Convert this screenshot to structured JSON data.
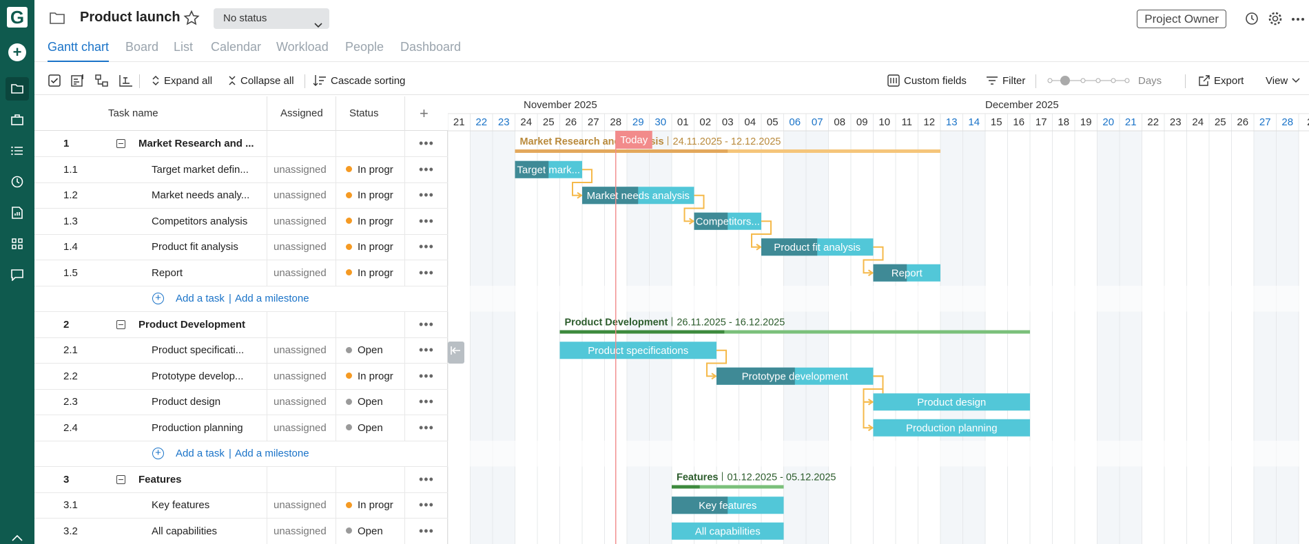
{
  "sidebar": {
    "logo": "G",
    "add_label": "+"
  },
  "header": {
    "title": "Product launch",
    "status_label": "No status",
    "owner_label": "Project Owner"
  },
  "tabs": [
    {
      "label": "Gantt chart",
      "active": true
    },
    {
      "label": "Board"
    },
    {
      "label": "List"
    },
    {
      "label": "Calendar"
    },
    {
      "label": "Workload"
    },
    {
      "label": "People"
    },
    {
      "label": "Dashboard"
    }
  ],
  "toolbar": {
    "expand_all": "Expand all",
    "collapse_all": "Collapse all",
    "cascade_sorting": "Cascade sorting",
    "custom_fields": "Custom fields",
    "filter": "Filter",
    "scale": "Days",
    "export": "Export",
    "view": "View"
  },
  "grid": {
    "headers": {
      "task_name": "Task name",
      "assigned": "Assigned",
      "status": "Status",
      "add": "+"
    },
    "add_task": "Add a task",
    "add_milestone": "Add a milestone",
    "rows": [
      {
        "type": "group",
        "num": "1",
        "name": "Market Research and ...",
        "assigned": "",
        "status": ""
      },
      {
        "type": "task",
        "num": "1.1",
        "name": "Target market defin...",
        "assigned": "unassigned",
        "status": "In progr",
        "status_color": "#f59a23"
      },
      {
        "type": "task",
        "num": "1.2",
        "name": "Market needs analy...",
        "assigned": "unassigned",
        "status": "In progr",
        "status_color": "#f59a23"
      },
      {
        "type": "task",
        "num": "1.3",
        "name": "Competitors analysis",
        "assigned": "unassigned",
        "status": "In progr",
        "status_color": "#f59a23"
      },
      {
        "type": "task",
        "num": "1.4",
        "name": "Product fit analysis",
        "assigned": "unassigned",
        "status": "In progr",
        "status_color": "#f59a23"
      },
      {
        "type": "task",
        "num": "1.5",
        "name": "Report",
        "assigned": "unassigned",
        "status": "In progr",
        "status_color": "#f59a23"
      },
      {
        "type": "add"
      },
      {
        "type": "group",
        "num": "2",
        "name": "Product Development",
        "assigned": "",
        "status": ""
      },
      {
        "type": "task",
        "num": "2.1",
        "name": "Product specificati...",
        "assigned": "unassigned",
        "status": "Open",
        "status_color": "#9a9a9a"
      },
      {
        "type": "task",
        "num": "2.2",
        "name": "Prototype develop...",
        "assigned": "unassigned",
        "status": "In progr",
        "status_color": "#f59a23"
      },
      {
        "type": "task",
        "num": "2.3",
        "name": "Product design",
        "assigned": "unassigned",
        "status": "Open",
        "status_color": "#9a9a9a"
      },
      {
        "type": "task",
        "num": "2.4",
        "name": "Production planning",
        "assigned": "unassigned",
        "status": "Open",
        "status_color": "#9a9a9a"
      },
      {
        "type": "add"
      },
      {
        "type": "group",
        "num": "3",
        "name": "Features",
        "assigned": "",
        "status": ""
      },
      {
        "type": "task",
        "num": "3.1",
        "name": "Key features",
        "assigned": "unassigned",
        "status": "In progr",
        "status_color": "#f59a23"
      },
      {
        "type": "task",
        "num": "3.2",
        "name": "All capabilities",
        "assigned": "unassigned",
        "status": "Open",
        "status_color": "#9a9a9a"
      }
    ]
  },
  "gantt": {
    "months": [
      {
        "label": "November 2025",
        "start_index": 0
      },
      {
        "label": "December 2025",
        "start_index": 10
      }
    ],
    "days": [
      {
        "d": "21",
        "we": false
      },
      {
        "d": "22",
        "we": true
      },
      {
        "d": "23",
        "we": true
      },
      {
        "d": "24",
        "we": false
      },
      {
        "d": "25",
        "we": false
      },
      {
        "d": "26",
        "we": false
      },
      {
        "d": "27",
        "we": false
      },
      {
        "d": "28",
        "we": false
      },
      {
        "d": "29",
        "we": true
      },
      {
        "d": "30",
        "we": true
      },
      {
        "d": "01",
        "we": false
      },
      {
        "d": "02",
        "we": false
      },
      {
        "d": "03",
        "we": false
      },
      {
        "d": "04",
        "we": false
      },
      {
        "d": "05",
        "we": false
      },
      {
        "d": "06",
        "we": true
      },
      {
        "d": "07",
        "we": true
      },
      {
        "d": "08",
        "we": false
      },
      {
        "d": "09",
        "we": false
      },
      {
        "d": "10",
        "we": false
      },
      {
        "d": "11",
        "we": false
      },
      {
        "d": "12",
        "we": false
      },
      {
        "d": "13",
        "we": true
      },
      {
        "d": "14",
        "we": true
      },
      {
        "d": "15",
        "we": false
      },
      {
        "d": "16",
        "we": false
      },
      {
        "d": "17",
        "we": false
      },
      {
        "d": "18",
        "we": false
      },
      {
        "d": "19",
        "we": false
      },
      {
        "d": "20",
        "we": true
      },
      {
        "d": "21",
        "we": true
      },
      {
        "d": "22",
        "we": false
      },
      {
        "d": "23",
        "we": false
      },
      {
        "d": "24",
        "we": false
      },
      {
        "d": "25",
        "we": false
      },
      {
        "d": "26",
        "we": false
      },
      {
        "d": "27",
        "we": true
      },
      {
        "d": "28",
        "we": true
      },
      {
        "d": "2",
        "we": false
      }
    ],
    "today_label": "Today",
    "today_index": 7.5,
    "colors": {
      "weekend": "#1a73c8",
      "summary1": "#f5c57a",
      "summary1_done": "#e3a85c",
      "summary1_text": "#b98a3c",
      "summary2": "#7ac07a",
      "summary2_done": "#3d8a3d",
      "summary2_text": "#2c5c2c",
      "task": "#52c7d8",
      "task_done": "#3f8a96",
      "link": "#f5b94a",
      "today": "#f28b8b"
    },
    "bars": [
      {
        "kind": "summary",
        "row": 0,
        "start": 3,
        "end": 22,
        "progress": 0.5,
        "label": "Market Research and Analysis",
        "dates": "24.11.2025 - 12.12.2025",
        "palette": 1
      },
      {
        "kind": "task",
        "row": 1,
        "start": 3,
        "end": 6,
        "progress": 0.5,
        "label": "Target mark..."
      },
      {
        "kind": "task",
        "row": 2,
        "start": 6,
        "end": 11,
        "progress": 0.5,
        "label": "Market needs analysis"
      },
      {
        "kind": "task",
        "row": 3,
        "start": 11,
        "end": 14,
        "progress": 0.5,
        "label": "Competitors..."
      },
      {
        "kind": "task",
        "row": 4,
        "start": 14,
        "end": 19,
        "progress": 0.5,
        "label": "Product fit analysis"
      },
      {
        "kind": "task",
        "row": 5,
        "start": 19,
        "end": 22,
        "progress": 0.5,
        "label": "Report"
      },
      {
        "kind": "summary",
        "row": 7,
        "start": 5,
        "end": 26,
        "progress": 0.35,
        "label": "Product Development",
        "dates": "26.11.2025 - 16.12.2025",
        "palette": 2
      },
      {
        "kind": "task",
        "row": 8,
        "start": 5,
        "end": 12,
        "progress": 0,
        "label": "Product specifications"
      },
      {
        "kind": "task",
        "row": 9,
        "start": 12,
        "end": 19,
        "progress": 0.5,
        "label": "Prototype development"
      },
      {
        "kind": "task",
        "row": 10,
        "start": 19,
        "end": 26,
        "progress": 0,
        "label": "Product design"
      },
      {
        "kind": "task",
        "row": 11,
        "start": 19,
        "end": 26,
        "progress": 0,
        "label": "Production planning"
      },
      {
        "kind": "summary",
        "row": 13,
        "start": 10,
        "end": 15,
        "progress": 0.25,
        "label": "Features",
        "dates": "01.12.2025 - 05.12.2025",
        "palette": 2
      },
      {
        "kind": "task",
        "row": 14,
        "start": 10,
        "end": 15,
        "progress": 0.5,
        "label": "Key features"
      },
      {
        "kind": "task",
        "row": 15,
        "start": 10,
        "end": 15,
        "progress": 0,
        "label": "All capabilities"
      }
    ],
    "links": [
      [
        1,
        2
      ],
      [
        2,
        3
      ],
      [
        3,
        4
      ],
      [
        4,
        5
      ],
      [
        8,
        9
      ],
      [
        9,
        10
      ],
      [
        9,
        11
      ]
    ]
  }
}
